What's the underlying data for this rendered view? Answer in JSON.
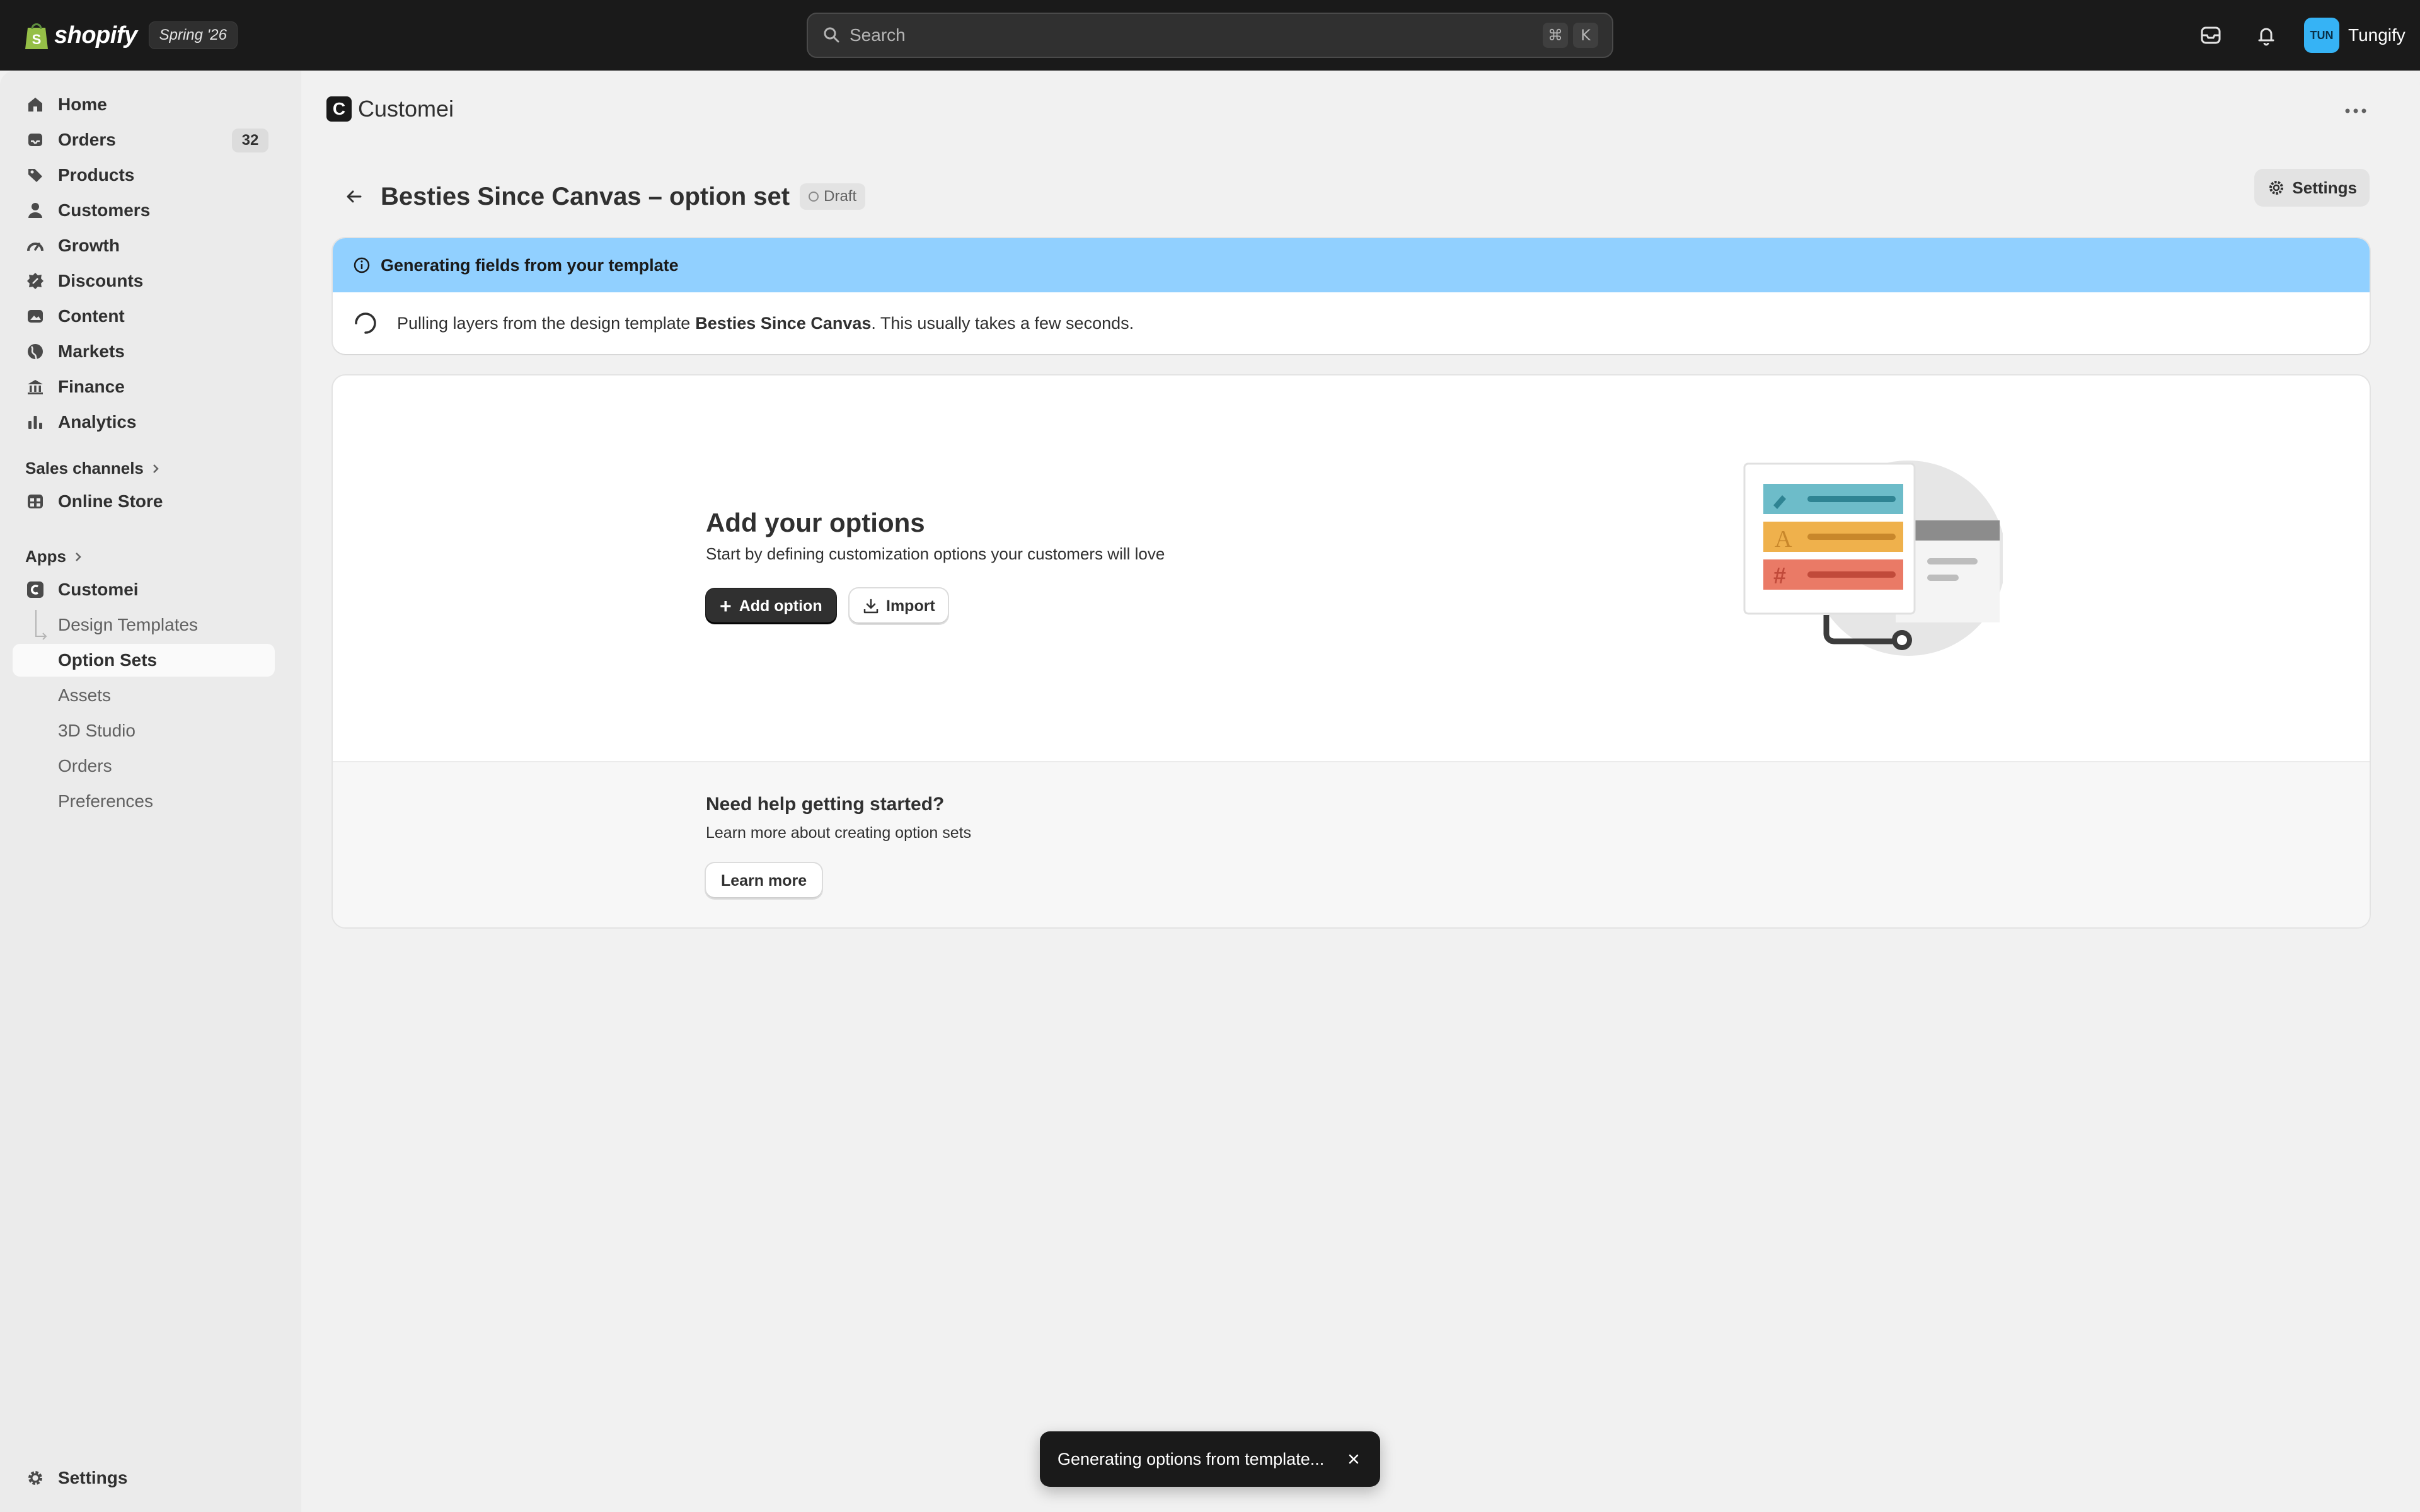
{
  "topbar": {
    "brand": "shopify",
    "edition": "Spring '26",
    "search_placeholder": "Search",
    "shortcut_keys": [
      "⌘",
      "K"
    ],
    "user_initials": "TUN",
    "user_name": "Tungify"
  },
  "sidebar": {
    "main_items": [
      {
        "label": "Home",
        "icon": "home-icon"
      },
      {
        "label": "Orders",
        "icon": "orders-icon",
        "count": "32"
      },
      {
        "label": "Products",
        "icon": "tag-icon"
      },
      {
        "label": "Customers",
        "icon": "person-icon"
      },
      {
        "label": "Growth",
        "icon": "gauge-icon"
      },
      {
        "label": "Discounts",
        "icon": "discount-icon"
      },
      {
        "label": "Content",
        "icon": "image-icon"
      },
      {
        "label": "Markets",
        "icon": "globe-icon"
      },
      {
        "label": "Finance",
        "icon": "bank-icon"
      },
      {
        "label": "Analytics",
        "icon": "bar-chart-icon"
      }
    ],
    "sales_channels_label": "Sales channels",
    "online_store_label": "Online Store",
    "apps_label": "Apps",
    "app_name": "Customei",
    "app_sub_items": [
      "Design Templates",
      "Option Sets",
      "Assets",
      "3D Studio",
      "Orders",
      "Preferences"
    ],
    "active_sub_item": "Option Sets",
    "settings_label": "Settings"
  },
  "main": {
    "app_title": "Customei",
    "app_logo_letter": "C",
    "page_title": "Besties Since Canvas – option set",
    "status_badge": "Draft",
    "settings_button": "Settings",
    "banner": {
      "title": "Generating fields from your template",
      "text_before": "Pulling layers from the design template",
      "template_name": "Besties Since Canvas",
      "text_after": ". This usually takes a few seconds."
    },
    "empty_state": {
      "heading": "Add your options",
      "subtext": "Start by defining customization options your customers will love",
      "primary_button": "Add option",
      "secondary_button": "Import"
    },
    "help": {
      "title": "Need help getting started?",
      "subtext": "Learn more about creating option sets",
      "button": "Learn more"
    }
  },
  "toast": {
    "message": "Generating options from template..."
  },
  "colors": {
    "topbar_bg": "#1a1a1a",
    "banner_header": "#91d0ff",
    "avatar": "#36b3f5",
    "illustration_teal": "#6dbcc9",
    "illustration_yellow": "#efb14c",
    "illustration_red": "#ea7a66"
  }
}
